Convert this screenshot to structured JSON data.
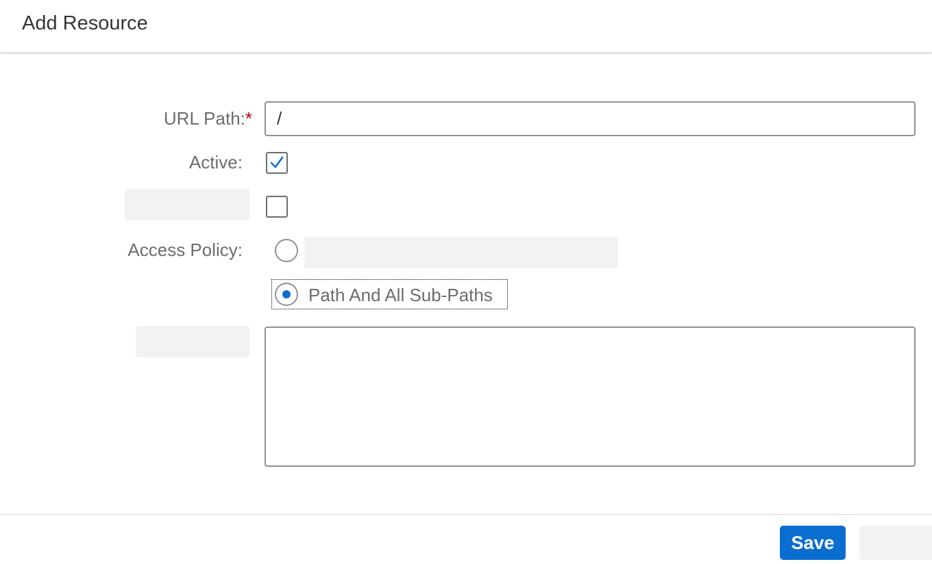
{
  "dialog": {
    "title": "Add Resource"
  },
  "form": {
    "url_path": {
      "label": "URL Path:",
      "required_marker": "*",
      "value": "/"
    },
    "active": {
      "label": "Active:",
      "checked": true
    },
    "unnamed_checkbox": {
      "checked": false
    },
    "access_policy": {
      "label": "Access Policy:",
      "options": [
        {
          "label": "",
          "selected": false
        },
        {
          "label": "Path And All Sub-Paths",
          "selected": true
        }
      ]
    },
    "description": {
      "value": ""
    }
  },
  "footer": {
    "save_label": "Save"
  },
  "colors": {
    "accent": "#0a6ed1",
    "required": "#bb0000",
    "label": "#6a6d70"
  }
}
